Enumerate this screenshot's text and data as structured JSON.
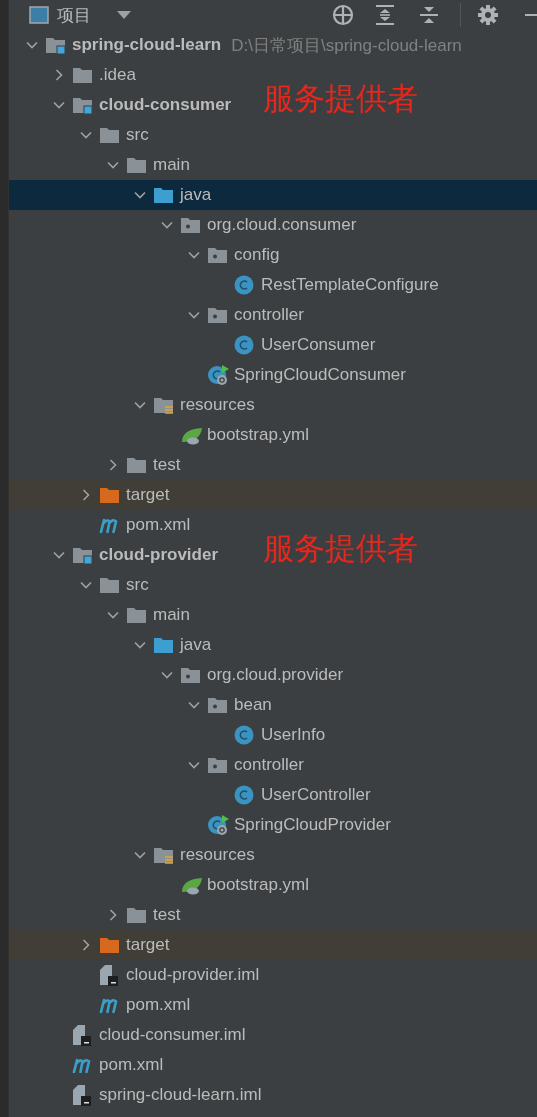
{
  "header": {
    "title": "项目"
  },
  "tree": [
    {
      "name": "spring-cloud-learn",
      "path": "D:\\日常项目\\spring-cloud-learn",
      "kind": "module",
      "expanded": true,
      "selected": false,
      "children": [
        {
          "name": ".idea",
          "kind": "folder",
          "expanded": false,
          "selected": false
        },
        {
          "name": "cloud-consumer",
          "kind": "module",
          "expanded": true,
          "selected": false,
          "annotation": "服务提供者",
          "children": [
            {
              "name": "src",
              "kind": "folder",
              "expanded": true,
              "selected": false,
              "children": [
                {
                  "name": "main",
                  "kind": "folder",
                  "expanded": true,
                  "selected": false,
                  "children": [
                    {
                      "name": "java",
                      "kind": "source",
                      "expanded": true,
                      "selected": true,
                      "children": [
                        {
                          "name": "org.cloud.consumer",
                          "kind": "package",
                          "expanded": true,
                          "selected": false,
                          "children": [
                            {
                              "name": "config",
                              "kind": "package",
                              "expanded": true,
                              "selected": false,
                              "children": [
                                {
                                  "name": "RestTemplateConfigure",
                                  "kind": "class",
                                  "selected": false
                                }
                              ]
                            },
                            {
                              "name": "controller",
                              "kind": "package",
                              "expanded": true,
                              "selected": false,
                              "children": [
                                {
                                  "name": "UserConsumer",
                                  "kind": "class",
                                  "selected": false
                                }
                              ]
                            },
                            {
                              "name": "SpringCloudConsumer",
                              "kind": "boot",
                              "selected": false
                            }
                          ]
                        }
                      ]
                    },
                    {
                      "name": "resources",
                      "kind": "resources",
                      "expanded": true,
                      "selected": false,
                      "children": [
                        {
                          "name": "bootstrap.yml",
                          "kind": "yml",
                          "selected": false
                        }
                      ]
                    }
                  ]
                },
                {
                  "name": "test",
                  "kind": "folder",
                  "expanded": false,
                  "selected": false
                }
              ]
            },
            {
              "name": "target",
              "kind": "excluded",
              "expanded": false,
              "selected": false
            },
            {
              "name": "pom.xml",
              "kind": "maven",
              "selected": false
            }
          ]
        },
        {
          "name": "cloud-provider",
          "kind": "module",
          "expanded": true,
          "selected": false,
          "annotation": "服务提供者",
          "children": [
            {
              "name": "src",
              "kind": "folder",
              "expanded": true,
              "selected": false,
              "children": [
                {
                  "name": "main",
                  "kind": "folder",
                  "expanded": true,
                  "selected": false,
                  "children": [
                    {
                      "name": "java",
                      "kind": "source",
                      "expanded": true,
                      "selected": false,
                      "children": [
                        {
                          "name": "org.cloud.provider",
                          "kind": "package",
                          "expanded": true,
                          "selected": false,
                          "children": [
                            {
                              "name": "bean",
                              "kind": "package",
                              "expanded": true,
                              "selected": false,
                              "children": [
                                {
                                  "name": "UserInfo",
                                  "kind": "class",
                                  "selected": false
                                }
                              ]
                            },
                            {
                              "name": "controller",
                              "kind": "package",
                              "expanded": true,
                              "selected": false,
                              "children": [
                                {
                                  "name": "UserController",
                                  "kind": "class",
                                  "selected": false
                                }
                              ]
                            },
                            {
                              "name": "SpringCloudProvider",
                              "kind": "boot",
                              "selected": false
                            }
                          ]
                        }
                      ]
                    },
                    {
                      "name": "resources",
                      "kind": "resources",
                      "expanded": true,
                      "selected": false,
                      "children": [
                        {
                          "name": "bootstrap.yml",
                          "kind": "yml",
                          "selected": false
                        }
                      ]
                    }
                  ]
                },
                {
                  "name": "test",
                  "kind": "folder",
                  "expanded": false,
                  "selected": false
                }
              ]
            },
            {
              "name": "target",
              "kind": "excluded",
              "expanded": false,
              "selected": false
            },
            {
              "name": "cloud-provider.iml",
              "kind": "iml",
              "selected": false
            },
            {
              "name": "pom.xml",
              "kind": "maven",
              "selected": false
            }
          ]
        },
        {
          "name": "cloud-consumer.iml",
          "kind": "iml",
          "selected": false
        },
        {
          "name": "pom.xml",
          "kind": "maven",
          "selected": false
        },
        {
          "name": "spring-cloud-learn.iml",
          "kind": "iml",
          "selected": false
        }
      ]
    }
  ]
}
